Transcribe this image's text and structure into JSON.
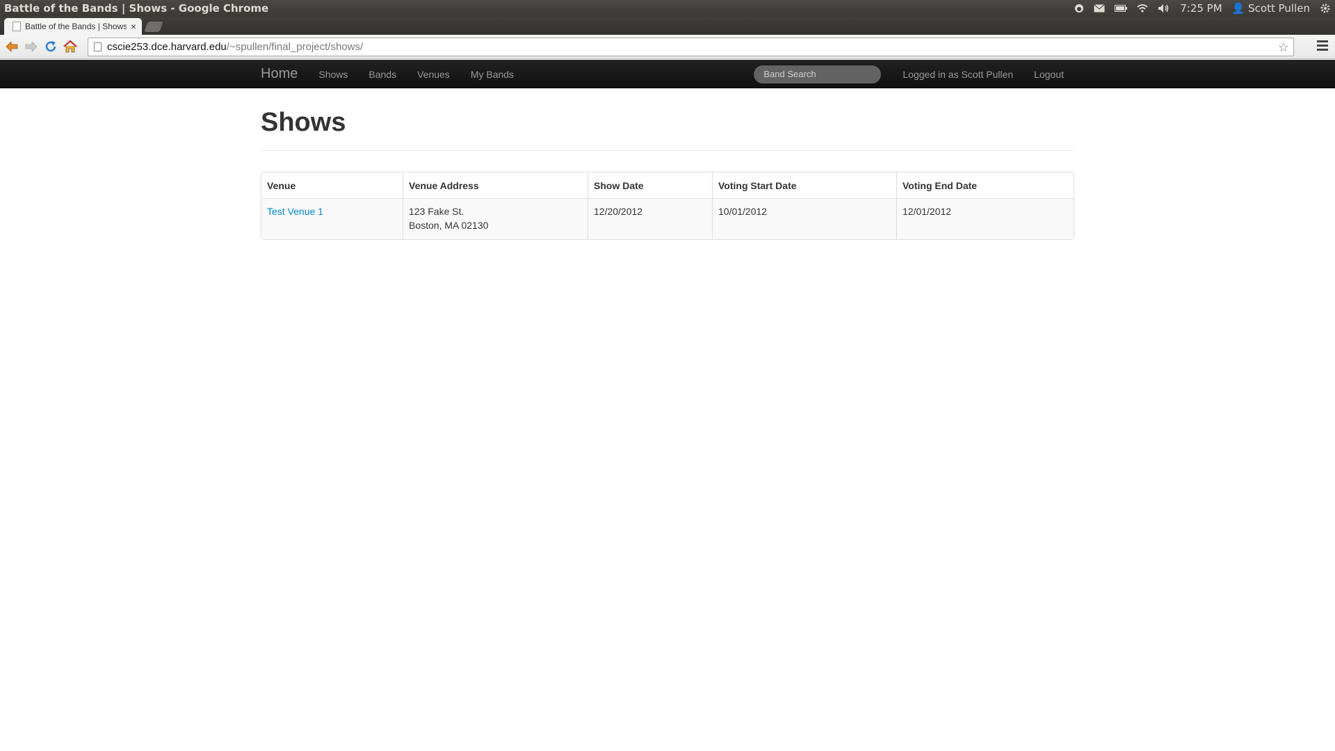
{
  "os_panel": {
    "window_title": "Battle of the Bands | Shows - Google Chrome",
    "clock": "7:25 PM",
    "user": "Scott Pullen"
  },
  "browser": {
    "tab_title": "Battle of the Bands | Shows",
    "url_host": "cscie253.dce.harvard.edu",
    "url_path": "/~spullen/final_project/shows/"
  },
  "navbar": {
    "brand": "Home",
    "links": [
      "Shows",
      "Bands",
      "Venues",
      "My Bands"
    ],
    "search_placeholder": "Band Search",
    "logged_in_text": "Logged in as Scott Pullen",
    "logout": "Logout"
  },
  "page": {
    "title": "Shows",
    "table": {
      "headers": [
        "Venue",
        "Venue Address",
        "Show Date",
        "Voting Start Date",
        "Voting End Date"
      ],
      "rows": [
        {
          "venue": "Test Venue 1",
          "address_line1": "123 Fake St.",
          "address_line2": "Boston, MA 02130",
          "show_date": "12/20/2012",
          "voting_start": "10/01/2012",
          "voting_end": "12/01/2012"
        }
      ]
    }
  }
}
